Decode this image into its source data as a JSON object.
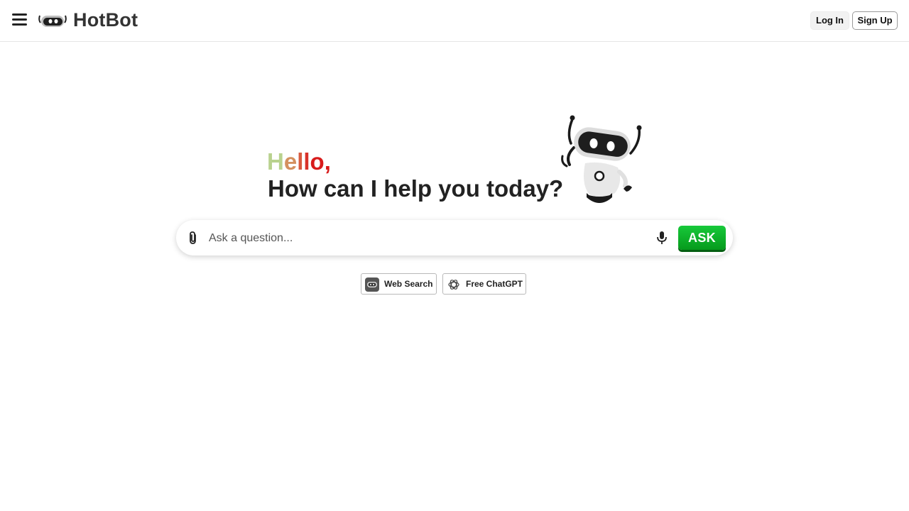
{
  "header": {
    "brand": "HotBot",
    "login_label": "Log In",
    "signup_label": "Sign Up"
  },
  "greeting": {
    "hello_letters": [
      "H",
      "e",
      "l",
      "l",
      "o",
      ","
    ],
    "hello_colors": [
      "#b9d28e",
      "#d4905e",
      "#d85a3e",
      "#d8322a",
      "#d81c1c",
      "#d81c1c"
    ],
    "subtitle": "How can I help you today?"
  },
  "search": {
    "placeholder": "Ask a question...",
    "value": "",
    "ask_label": "ASK"
  },
  "chips": {
    "web_search": "Web Search",
    "free_chatgpt": "Free ChatGPT"
  },
  "colors": {
    "ask_green": "#0aaa22"
  }
}
